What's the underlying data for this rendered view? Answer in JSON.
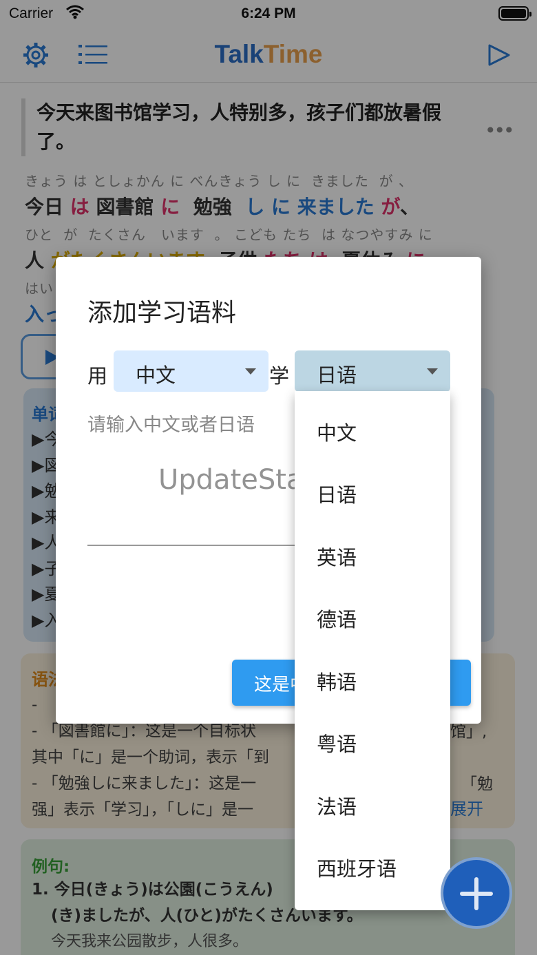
{
  "statusbar": {
    "carrier": "Carrier",
    "time": "6:24 PM"
  },
  "navbar": {
    "title_part1": "Talk",
    "title_part2": "Time"
  },
  "sentence": {
    "text": "今天来图书馆学习，人特别多，孩子们都放暑假了。"
  },
  "ruby": [
    {
      "furigana": "きょう は としょかん に べんきょう し に  きました  が 、"
    },
    {
      "furigana": "ひと  が  たくさん   います  。 こども たち  は なつやすみ に"
    },
    {
      "furigana": "はい"
    }
  ],
  "japanese_lines": {
    "l1": {
      "a": "今日 ",
      "b": "は ",
      "c": "図書館 ",
      "d": "に ",
      "e": " 勉強 ",
      "f": " し に ",
      "g": "来ました ",
      "h": "が",
      "i": "、"
    },
    "l2": {
      "a": "人 ",
      "b": "がたくさんいます",
      "c": "  子供 ",
      "d": "たち は ",
      "e": " 夏休み ",
      "f": "に"
    },
    "l3": {
      "a": "入っ"
    }
  },
  "vocab": {
    "title": "单词",
    "items": [
      "▶今",
      "▶図",
      "▶勉",
      "▶来",
      "▶人",
      "▶子",
      "▶夏",
      "▶入"
    ]
  },
  "grammar": {
    "title": "语法",
    "lines": [
      "-",
      "- 「図書館に」：这是一个目标状",
      "其中「に」是一个助词，表示「到",
      "- 「勉強しに来ました」：这是一",
      "强」表示「学习」，「しに」是一"
    ],
    "right_bits": [
      "馆」,",
      "「勉"
    ],
    "more": "展开"
  },
  "example": {
    "title": "例句:",
    "jp_line1": "1. 今日(きょう)は公園(こうえん)",
    "jp_line2": "(き)ましたが、人(ひと)がたくさんいます。",
    "zh": "今天我来公园散步，人很多。"
  },
  "dialog": {
    "title": "添加学习语料",
    "use_label": "用",
    "learn_label": "学",
    "from_value": "中文",
    "to_value": "日语",
    "input_placeholder": "请输入中文或者日语",
    "confirm_label": "这是中"
  },
  "language_menu": {
    "options": [
      "中文",
      "日语",
      "英语",
      "德语",
      "韩语",
      "粤语",
      "法语",
      "西班牙语"
    ]
  },
  "watermark": "UpdateStar.com"
}
